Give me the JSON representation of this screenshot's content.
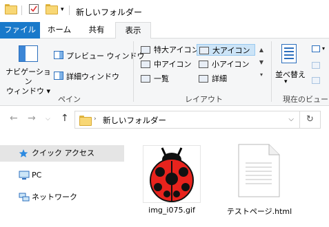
{
  "window": {
    "title": "新しいフォルダー",
    "quick_access_icons": [
      "folder-icon",
      "properties-check-icon",
      "new-folder-icon",
      "customize-dropdown-icon"
    ]
  },
  "ribbon_tabs": [
    {
      "label": "ファイル",
      "active": false
    },
    {
      "label": "ホーム",
      "active": false
    },
    {
      "label": "共有",
      "active": false
    },
    {
      "label": "表示",
      "active": true
    }
  ],
  "ribbon": {
    "pane_group": {
      "label": "ペイン",
      "navigation_pane_line1": "ナビゲーション",
      "navigation_pane_line2": "ウィンドウ ▾",
      "preview_pane": "プレビュー ウィンドウ",
      "details_pane": "詳細ウィンドウ"
    },
    "layout_group": {
      "label": "レイアウト",
      "items": [
        {
          "label": "特大アイコン",
          "selected": false
        },
        {
          "label": "大アイコン",
          "selected": true
        },
        {
          "label": "中アイコン",
          "selected": false
        },
        {
          "label": "小アイコン",
          "selected": false
        },
        {
          "label": "一覧",
          "selected": false
        },
        {
          "label": "詳細",
          "selected": false
        }
      ]
    },
    "current_view_group": {
      "label": "現在のビュー",
      "sort_label": "並べ替え"
    }
  },
  "address_bar": {
    "path": "新しいフォルダー"
  },
  "nav_pane": {
    "items": [
      {
        "label": "クイック アクセス",
        "icon": "star-icon",
        "selected": true
      },
      {
        "label": "PC",
        "icon": "pc-icon",
        "selected": false
      },
      {
        "label": "ネットワーク",
        "icon": "network-icon",
        "selected": false
      }
    ]
  },
  "files": [
    {
      "name": "img_i075.gif",
      "type": "image"
    },
    {
      "name": "テストページ.html",
      "type": "html"
    }
  ],
  "colors": {
    "file_tab": "#1979ca",
    "selection": "#cce4f7",
    "ladybug_red": "#e8231d"
  }
}
